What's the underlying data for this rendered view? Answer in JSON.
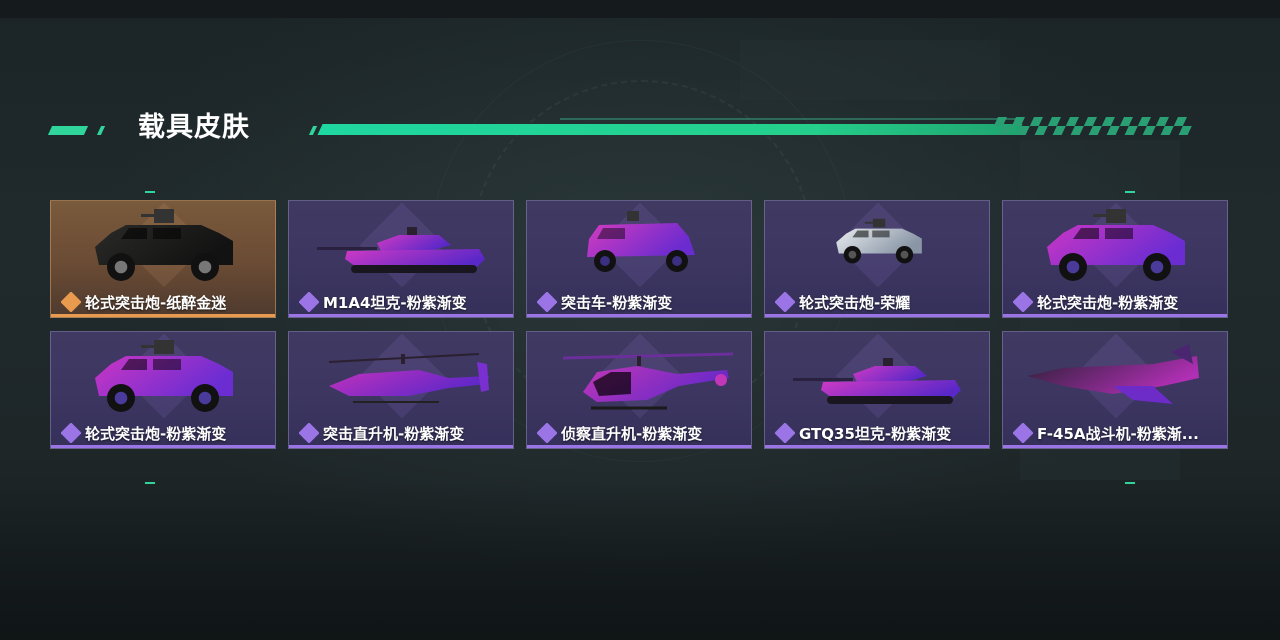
{
  "section": {
    "title": "载具皮肤"
  },
  "colors": {
    "accent_green": "#2fd59a",
    "rarity_purple": "#9b74e6",
    "rarity_gold": "#e89a4e"
  },
  "skins": [
    {
      "name": "轮式突击炮-纸醉金迷",
      "rarity": "gold",
      "kind": "wheeled-gun",
      "icon": "rarity-diamond-icon"
    },
    {
      "name": "M1A4坦克-粉紫渐变",
      "rarity": "purple",
      "kind": "tank",
      "icon": "rarity-diamond-icon"
    },
    {
      "name": "突击车-粉紫渐变",
      "rarity": "purple",
      "kind": "assault-car",
      "icon": "rarity-diamond-icon"
    },
    {
      "name": "轮式突击炮-荣耀",
      "rarity": "purple",
      "kind": "wheeled-gun-honor",
      "icon": "rarity-diamond-icon"
    },
    {
      "name": "轮式突击炮-粉紫渐变",
      "rarity": "purple",
      "kind": "wheeled-gun-pink",
      "icon": "rarity-diamond-icon"
    },
    {
      "name": "轮式突击炮-粉紫渐变",
      "rarity": "purple",
      "kind": "wheeled-gun-pink",
      "icon": "rarity-diamond-icon"
    },
    {
      "name": "突击直升机-粉紫渐变",
      "rarity": "purple",
      "kind": "attack-heli",
      "icon": "rarity-diamond-icon"
    },
    {
      "name": "侦察直升机-粉紫渐变",
      "rarity": "purple",
      "kind": "scout-heli",
      "icon": "rarity-diamond-icon"
    },
    {
      "name": "GTQ35坦克-粉紫渐变",
      "rarity": "purple",
      "kind": "tank2",
      "icon": "rarity-diamond-icon"
    },
    {
      "name": "F-45A战斗机-粉紫渐...",
      "rarity": "purple",
      "kind": "jet",
      "icon": "rarity-diamond-icon"
    }
  ]
}
